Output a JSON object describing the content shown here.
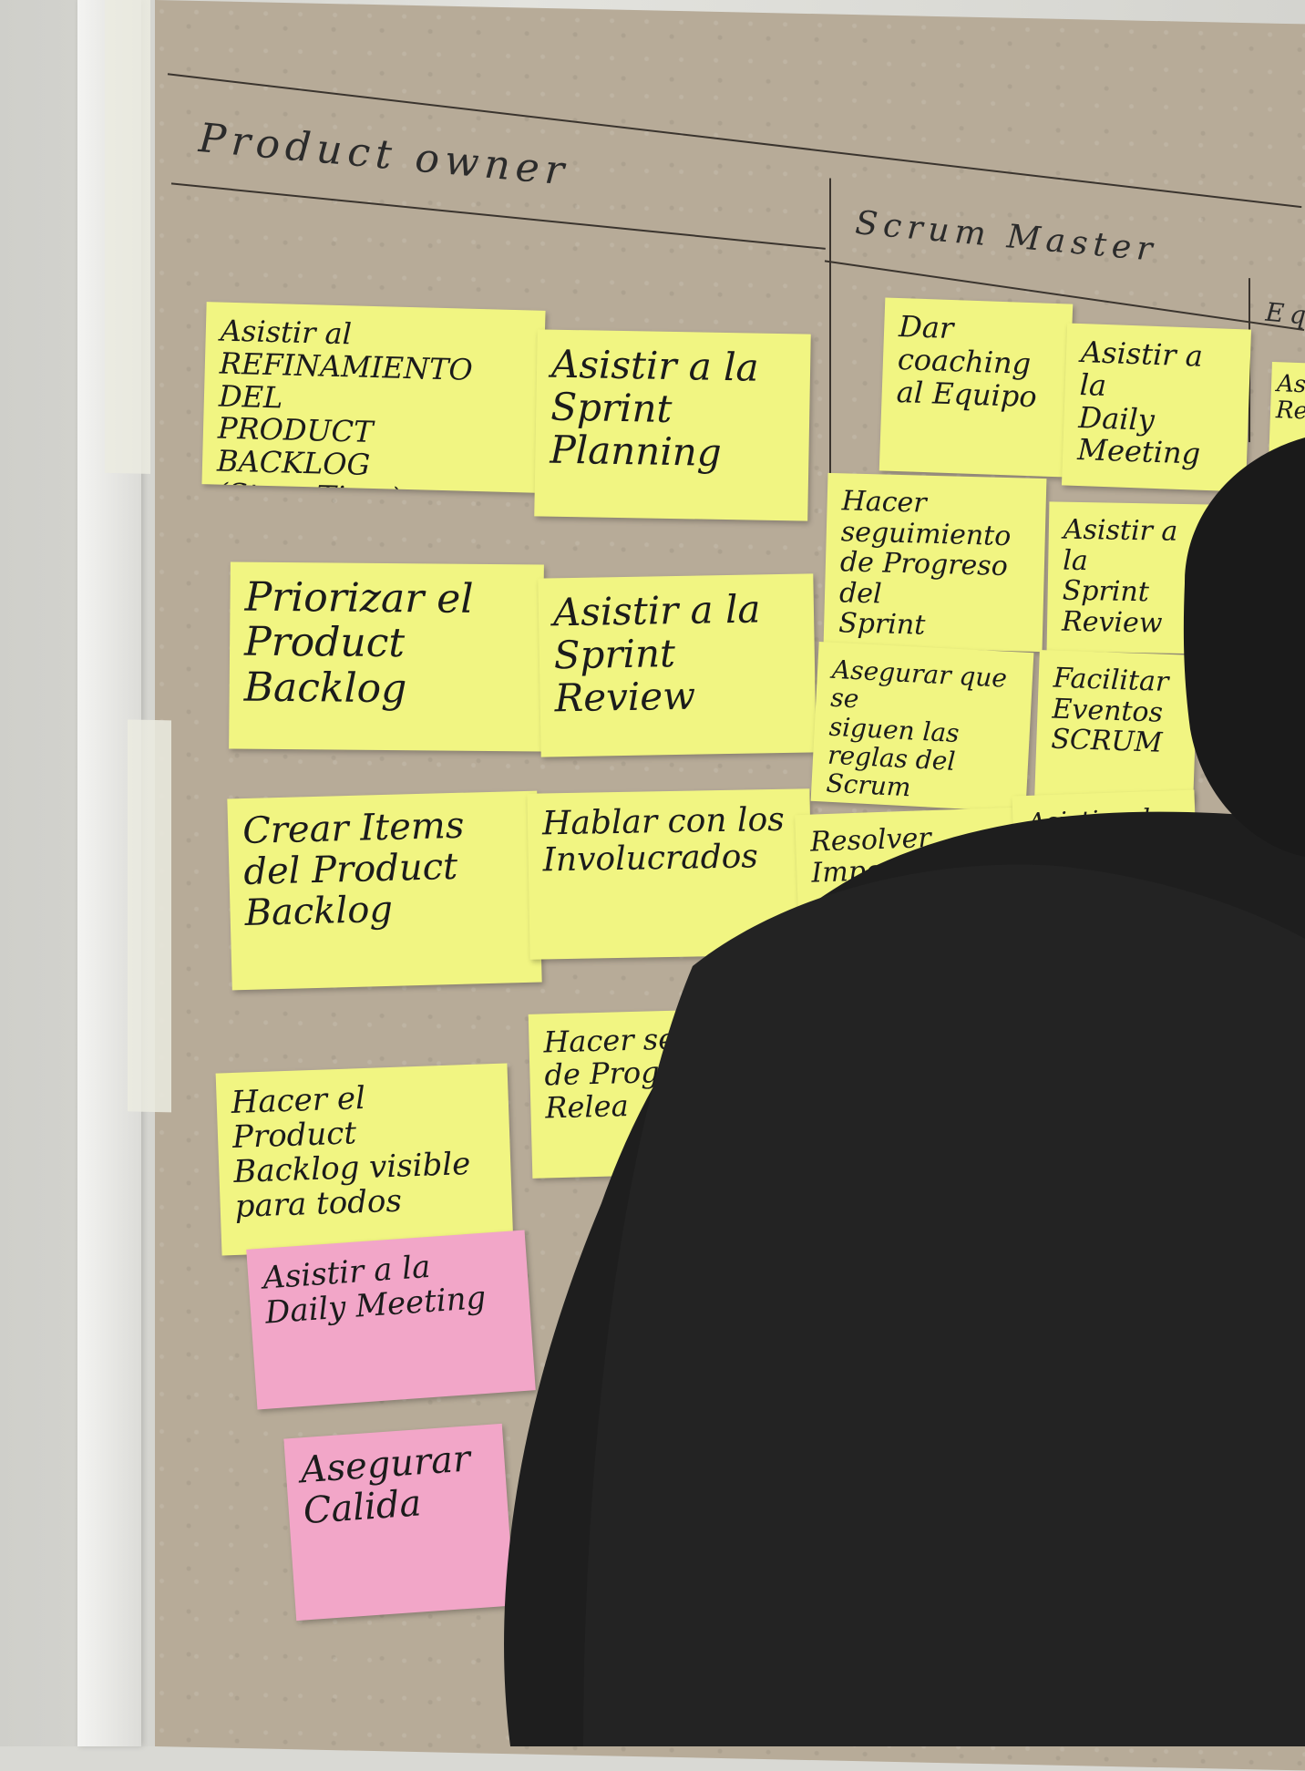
{
  "headings": {
    "product_owner": "Product owner",
    "scrum_master": "Scrum Master",
    "team_partial": "Eq"
  },
  "notes": {
    "po_refinement": "Asistir al\nREFINAMIENTO DEL\nPRODUCT BACKLOG\n(Story Time)",
    "po_sprint_planning": "Asistir a la\nSprint\nPlanning",
    "po_prioritize": "Priorizar el\nProduct\nBacklog",
    "po_sprint_review": "Asistir a la\nSprint\nReview",
    "po_create_items": "Crear Items\ndel Product\nBacklog",
    "po_talk_stakeholders": "Hablar con los\nInvolucrados",
    "po_release_progress": "Hacer segu\nde Progre\nRelea",
    "po_backlog_visible": "Hacer el Product\nBacklog visible\npara todos",
    "po_daily_meeting": "Asistir a la\nDaily Meeting",
    "po_quality": "Asegurar\nCalida",
    "sm_coaching": "Dar coaching\nal Equipo",
    "sm_daily_meeting": "Asistir a la\nDaily\nMeeting",
    "sm_sprint_progress": "Hacer seguimiento\nde Progreso del\nSprint",
    "sm_sprint_review": "Asistir a la\nSprint\nReview",
    "sm_scrum_rules": "Asegurar que se\nsiguen las\nreglas del Scrum",
    "sm_facilitate_events": "Facilitar\nEventos\nSCRUM",
    "sm_impediments": "Resolver Impedi-",
    "sm_asistir_partial": "Asistir a la",
    "team_partial_note": "As\nRe"
  },
  "colors": {
    "paper": "#b7ab98",
    "sticky_yellow": "#f1f582",
    "sticky_pink": "#f2a6c8",
    "ink": "#2b2b2b",
    "shirt": "#1e1e1e"
  }
}
